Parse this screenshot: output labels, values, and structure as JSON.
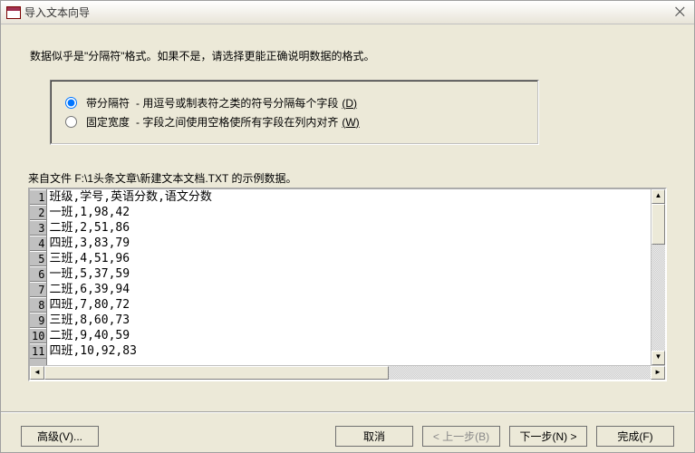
{
  "window": {
    "title": "导入文本向导",
    "close_glyph": "⨉"
  },
  "instruction": "数据似乎是\"分隔符\"格式。如果不是，请选择更能正确说明数据的格式。",
  "options": {
    "delimited": {
      "label": "带分隔符",
      "desc": "- 用逗号或制表符之类的符号分隔每个字段",
      "accel": "(D)",
      "checked": true
    },
    "fixed": {
      "label": "固定宽度",
      "desc": "- 字段之间使用空格使所有字段在列内对齐",
      "accel": "(W)",
      "checked": false
    }
  },
  "source_label": "来自文件 F:\\1头条文章\\新建文本文档.TXT 的示例数据。",
  "preview_rows": [
    {
      "n": "1",
      "text": "班级,学号,英语分数,语文分数"
    },
    {
      "n": "2",
      "text": "一班,1,98,42"
    },
    {
      "n": "3",
      "text": "二班,2,51,86"
    },
    {
      "n": "4",
      "text": "四班,3,83,79"
    },
    {
      "n": "5",
      "text": "三班,4,51,96"
    },
    {
      "n": "6",
      "text": "一班,5,37,59"
    },
    {
      "n": "7",
      "text": "二班,6,39,94"
    },
    {
      "n": "8",
      "text": "四班,7,80,72"
    },
    {
      "n": "9",
      "text": "三班,8,60,73"
    },
    {
      "n": "10",
      "text": "二班,9,40,59"
    },
    {
      "n": "11",
      "text": "四班,10,92,83"
    }
  ],
  "buttons": {
    "advanced": "高级(V)...",
    "cancel": "取消",
    "back": "< 上一步(B)",
    "next": "下一步(N) >",
    "finish": "完成(F)"
  },
  "scroll": {
    "up": "▲",
    "down": "▼",
    "left": "◄",
    "right": "►"
  }
}
